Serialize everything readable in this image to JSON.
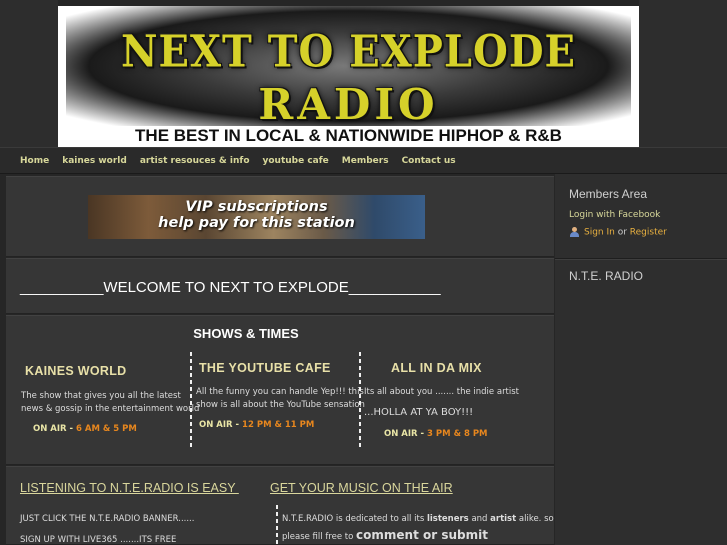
{
  "header": {
    "logo_line1": "NEXT TO EXPLODE",
    "logo_line2": "RADIO",
    "tagline": "THE BEST IN LOCAL & NATIONWIDE HIPHOP & R&B"
  },
  "nav": {
    "items": [
      "Home",
      "kaines world",
      "artist resouces & info",
      "youtube cafe",
      "Members",
      "Contact us"
    ]
  },
  "vip_banner": {
    "line1": "VIP subscriptions",
    "line2": "help pay for this station"
  },
  "welcome": {
    "text": "__________WELCOME TO NEXT TO EXPLODE___________"
  },
  "shows": {
    "title": "SHOWS & TIMES",
    "on_air_label": "ON AIR -",
    "list": [
      {
        "name": "KAINES WORLD",
        "desc1": "The show that gives you all the latest",
        "desc2": "news & gossip in the entertainment world",
        "times": "6 AM  & 5 PM"
      },
      {
        "name": "THE YOUTUBE CAFE",
        "desc1": " All the funny you can handle Yep!!! this",
        "desc2": "show is all about the YouTube sensation",
        "times": "12 PM & 11 PM"
      },
      {
        "name": "ALL IN DA MIX",
        "desc1": "Its all about you ....... the indie artist",
        "desc2": "...HOLLA AT YA BOY!!!",
        "times": "3 PM & 8 PM"
      }
    ]
  },
  "bottom": {
    "left_heading": "LISTENING TO N.T.E.RADIO IS EASY ",
    "left_line1": "JUST CLICK THE N.T.E.RADIO BANNER......",
    "left_line2": "SIGN UP WITH LIVE365 .......ITS FREE",
    "right_heading": "GET YOUR MUSIC ON THE AIR",
    "right_line1_a": "N.T.E.RADIO is dedicated to all its ",
    "right_line1_b": "listeners",
    "right_line1_c": " and ",
    "right_line1_d": "artist",
    "right_line1_e": " alike. so",
    "right_line2_a": "please fill free to ",
    "right_line2_b": "comment or submit"
  },
  "sidebar": {
    "members_title": "Members Area",
    "login_facebook": "Login with Facebook",
    "sign_in": "Sign In",
    "or": " or ",
    "register": "Register",
    "radio_title": "N.T.E. RADIO"
  }
}
